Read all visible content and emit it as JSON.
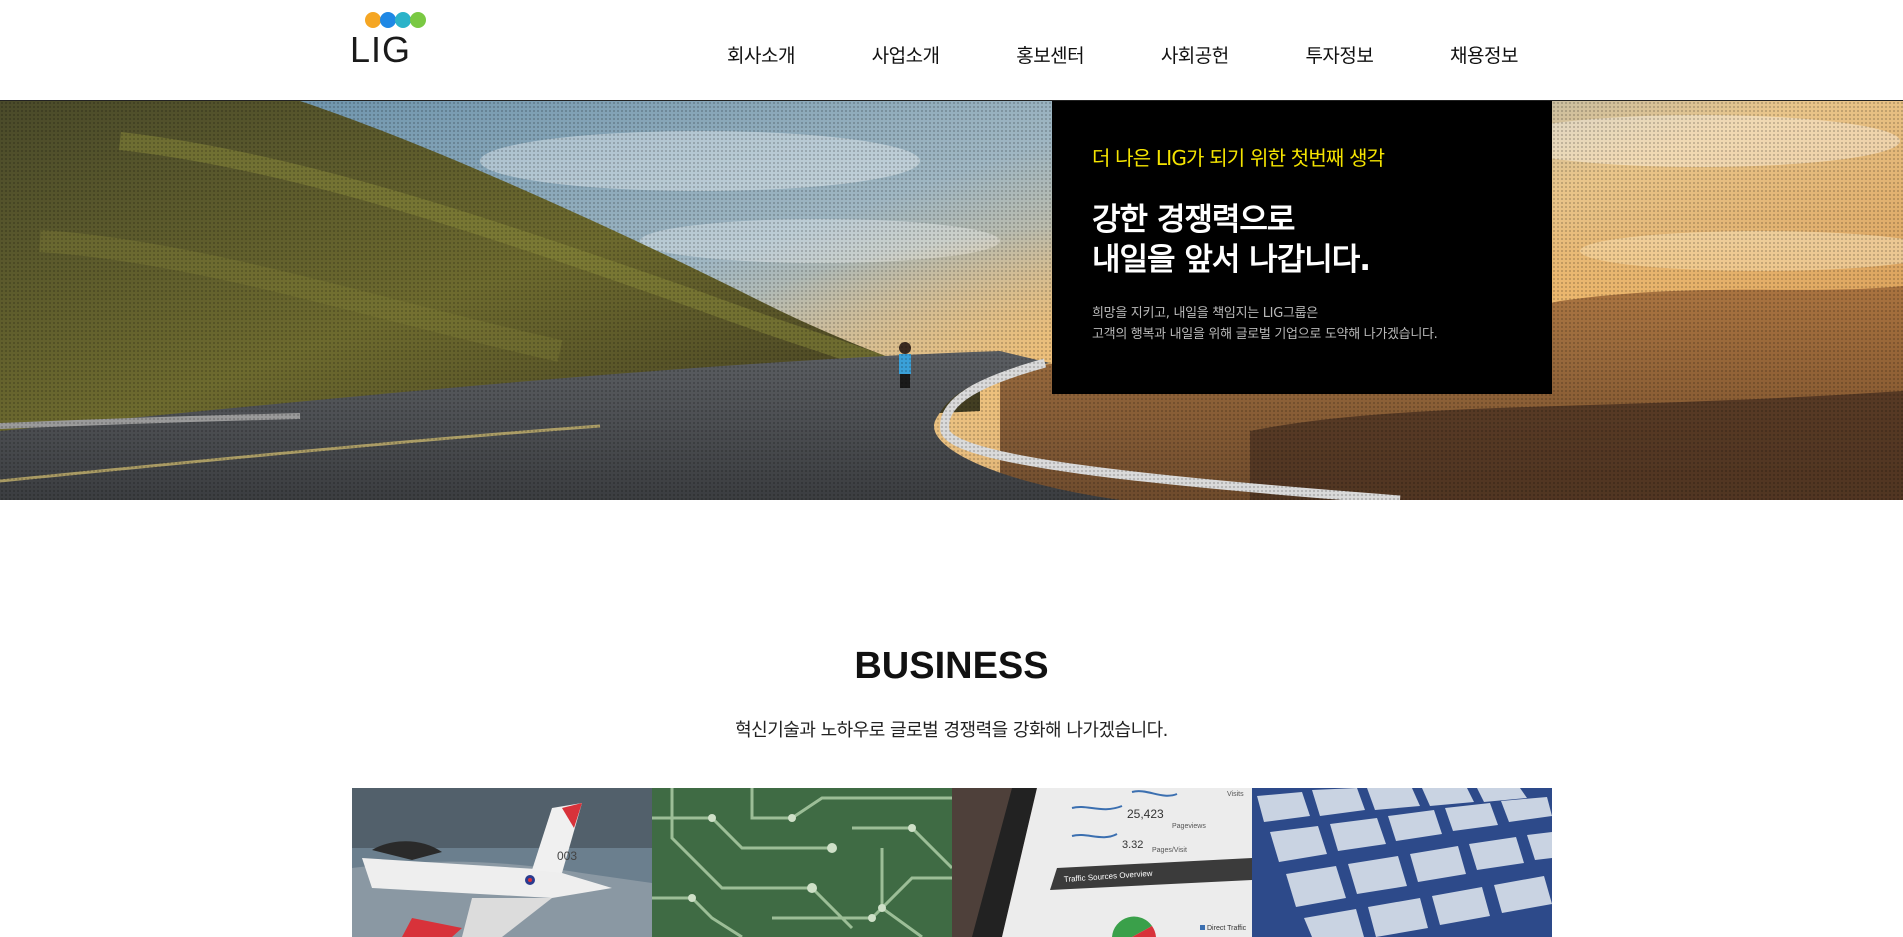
{
  "header": {
    "logo_text": "LIG",
    "nav": [
      "회사소개",
      "사업소개",
      "홍보센터",
      "사회공헌",
      "투자정보",
      "채용정보"
    ]
  },
  "hero": {
    "subtitle": "더 나은 LIG가 되기 위한 첫번째 생각",
    "title": "강한 경쟁력으로\n내일을 앞서 나갑니다.",
    "description": "희망을 지키고, 내일을 책임지는 LIG그룹은\n고객의 행복과 내일을 위해 글로벌 기업으로 도약해 나가겠습니다."
  },
  "business": {
    "title": "BUSINESS",
    "description": "혁신기술과 노하우로 글로벌 경쟁력을 강화해 나가겠습니다.",
    "card_image_text": {
      "aircraft_number": "003",
      "pageviews": "25,423",
      "pageviews_label": "Pageviews",
      "pages_per_visit": "3.32",
      "pages_per_visit_label": "Pages/Visit",
      "traffic_title": "Traffic Sources Overview",
      "legend_label": "Direct Traffic",
      "visits_label": "Visits"
    }
  },
  "colors": {
    "accent_yellow": "#f5e400",
    "logo_orange": "#f5a623",
    "logo_blue": "#1e88e5",
    "logo_green": "#7ac943"
  }
}
